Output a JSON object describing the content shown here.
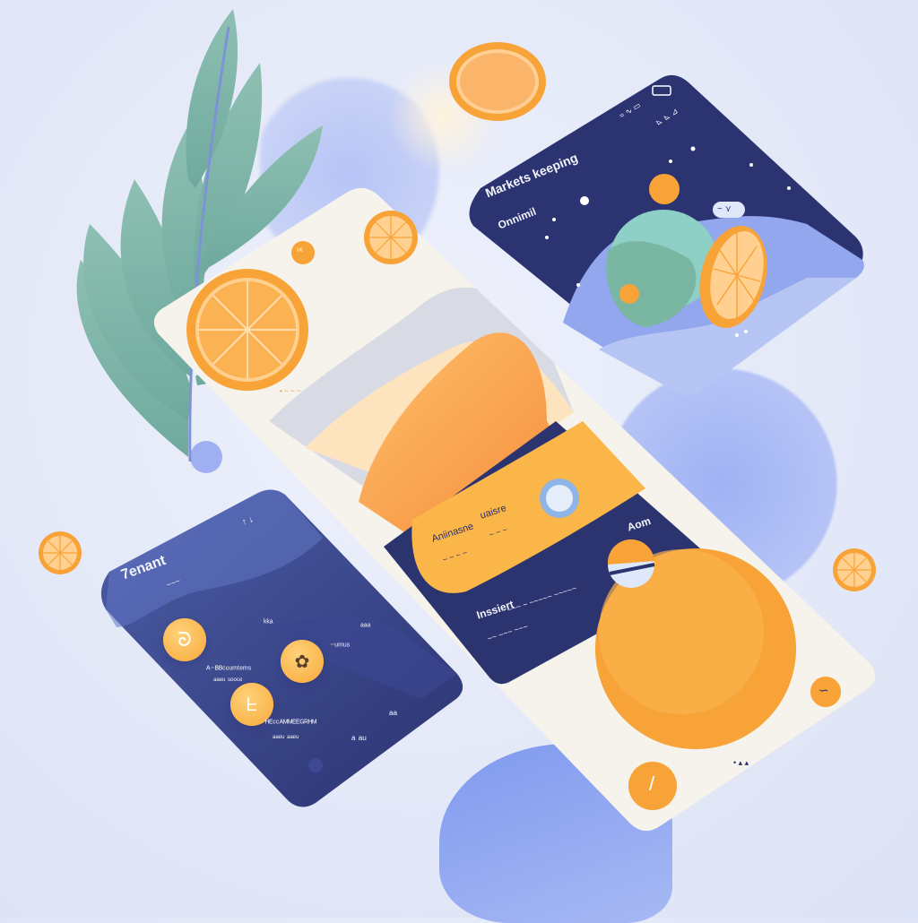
{
  "top_right_card": {
    "status_bar": "≈  ∿  ▭",
    "status_icons": "⊾ ⊾ ⊿",
    "title": "Markets keeping",
    "subtitle": "Onnimil",
    "chip": "~ ⋎"
  },
  "center_card": {
    "small_badge": "ᶸᵋ",
    "caption": "• ~ ~ ~",
    "panel_label_left": "Aniinasne",
    "panel_label_left_sub": "~ ~ ~ ~",
    "panel_label_right": "uaisre",
    "panel_label_right_sub": "~ ~ ~",
    "footer_title": "Inssiert",
    "footer_line1": "~~~ ~ ~~~~~ ~~~~~",
    "footer_line2": "~~ ~~~ ~~~",
    "time_label": "Aom",
    "side_label": "~ ~ ~",
    "orange_icon": "∽",
    "bottom_button": "/",
    "dots": "• ▴ ▴"
  },
  "left_card": {
    "title": "7enant",
    "subtitle": "~~~",
    "status": "↑ ↓",
    "row1_label": "ᵏᵏᵃ",
    "row2_label": "ᴬ⁻ᴮᴮᶜᵘᵘᵐᵗᵉᵐˢ",
    "row2_sub": "ᵃᵃᵉᵘ ˢᵒᵒᶜᵉ",
    "row3_label": "⁻ᵘᵐᵘˢ",
    "row4_label": "ᴴᴱᶜᶜᴬᴹᴹᴱᴱᴳᴿᴴᴹ",
    "row4_sub": "ᵃᵃᵉᵘ ᵃᵃᵉᵘ",
    "value_1": "ᵃ ᵃᵘ",
    "value_2": "ᵃᵃ",
    "value_3": "ᵃᵃᵃ",
    "icons": [
      "spiral-icon",
      "citrus-icon",
      "leaf-icon"
    ]
  },
  "colors": {
    "navy": "#2b3370",
    "orange": "#f6a63a",
    "periwinkle": "#8ea3ef",
    "sage": "#79b3a6",
    "cream": "#f5f2ea"
  }
}
